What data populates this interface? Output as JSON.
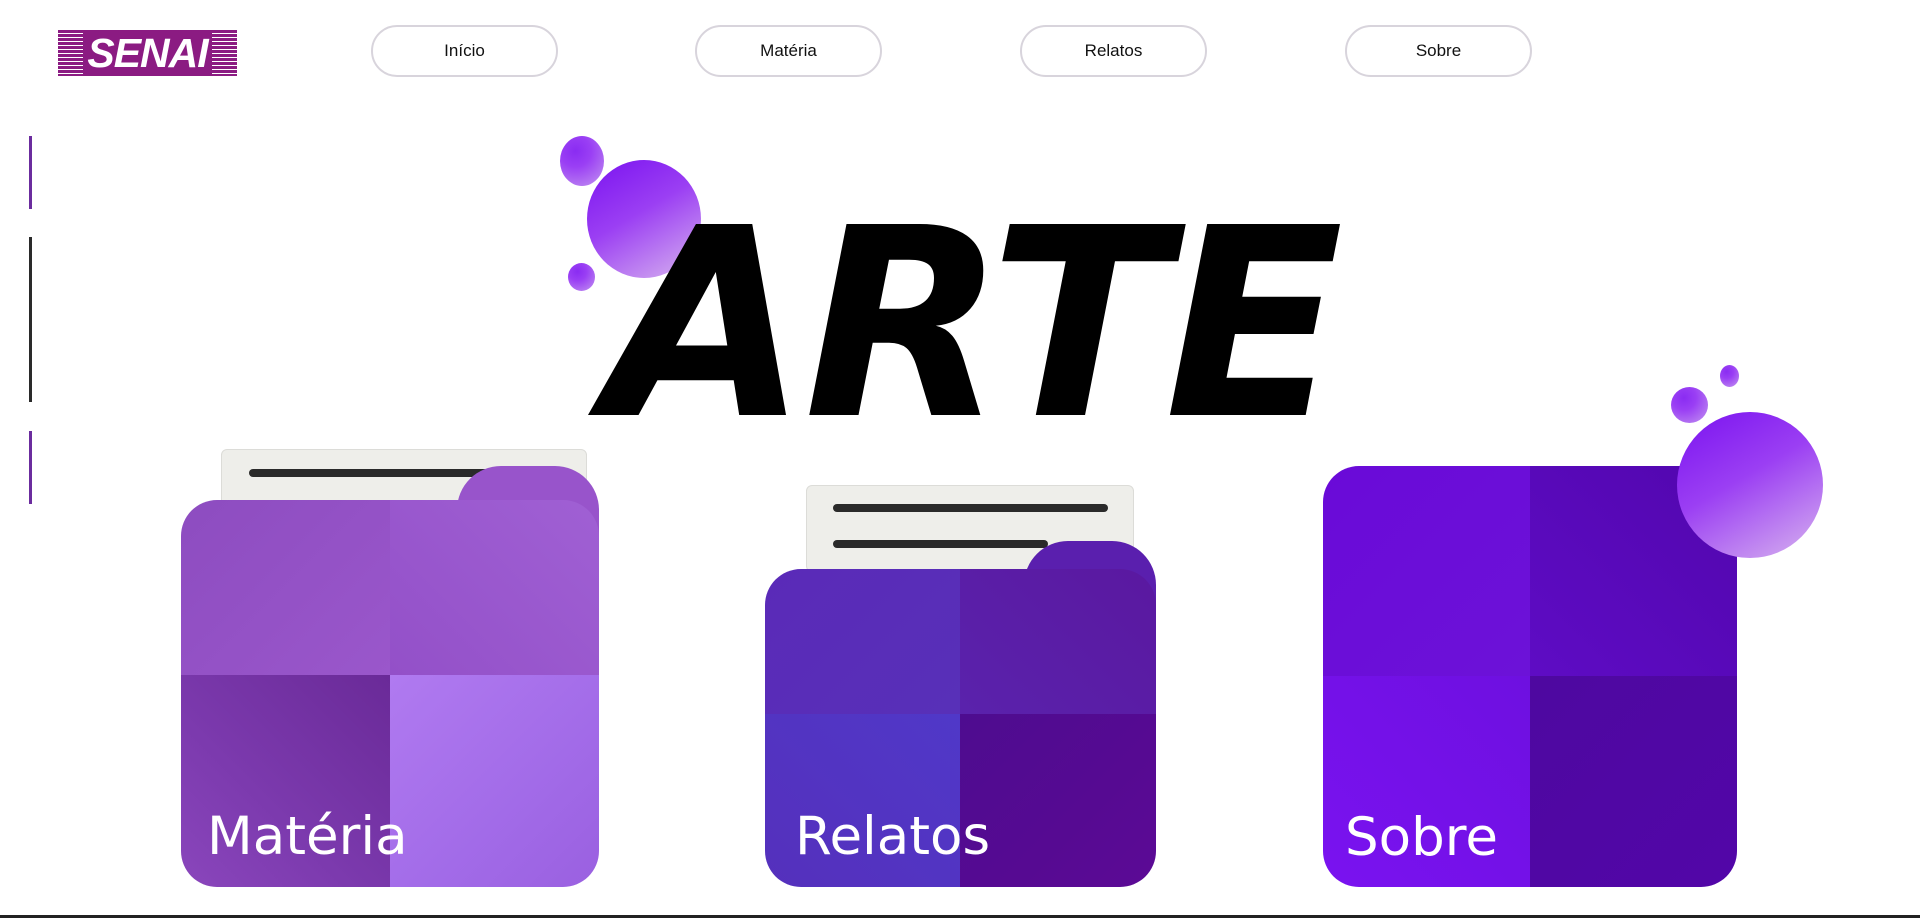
{
  "logo": {
    "text": "SENAI"
  },
  "nav": {
    "items": [
      {
        "label": "Início"
      },
      {
        "label": "Matéria"
      },
      {
        "label": "Relatos"
      },
      {
        "label": "Sobre"
      }
    ]
  },
  "hero": {
    "title": "ARTE"
  },
  "cards": [
    {
      "label": "Matéria"
    },
    {
      "label": "Relatos"
    },
    {
      "label": "Sobre"
    }
  ],
  "colors": {
    "brand": "#8b1b82",
    "accent_purple": "#7a12f0",
    "nav_border": "#d8d4dc",
    "side_purple": "#6b2c9e",
    "side_dark": "#2a2a2a"
  }
}
